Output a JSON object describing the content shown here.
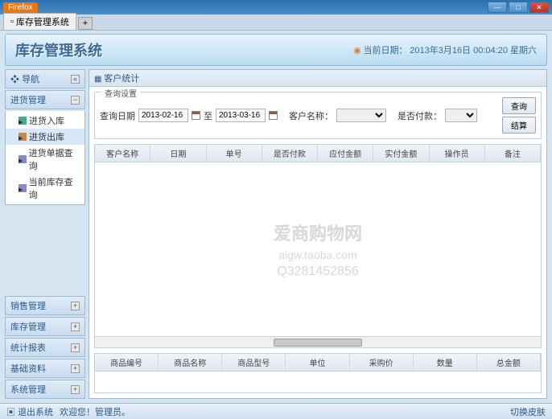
{
  "window": {
    "firefox": "Firefox",
    "tab_title": "库存管理系统"
  },
  "banner": {
    "title": "库存管理系统",
    "date_label": "当前日期：",
    "date_value": "2013年3月16日 00:04:20 星期六"
  },
  "nav": {
    "header": "导航",
    "sections": [
      {
        "title": "进货管理",
        "items": [
          "进货入库",
          "进货出库",
          "进货单据查询",
          "当前库存查询"
        ]
      },
      {
        "title": "销售管理"
      },
      {
        "title": "库存管理"
      },
      {
        "title": "统计报表"
      },
      {
        "title": "基础资料"
      },
      {
        "title": "系统管理"
      }
    ]
  },
  "content": {
    "tab": "客户统计",
    "fieldset_title": "查询设置",
    "labels": {
      "date": "查询日期",
      "to": "至",
      "cust": "客户名称：",
      "paid": "是否付款："
    },
    "values": {
      "date_from": "2013-02-16",
      "date_to": "2013-03-16",
      "cust": "",
      "paid": ""
    },
    "buttons": {
      "search": "查询",
      "settle": "结算"
    },
    "grid1_cols": [
      "客户名称",
      "日期",
      "单号",
      "是否付款",
      "应付金额",
      "实付金额",
      "操作员",
      "备注"
    ],
    "grid2_cols": [
      "商品编号",
      "商品名称",
      "商品型号",
      "单位",
      "采购价",
      "数量",
      "总金额"
    ]
  },
  "watermark": {
    "l1": "爱商购物网",
    "l2": "aigw.taoba.com",
    "l3": "Q3281452856"
  },
  "status": {
    "exit": "退出系统",
    "welcome": "欢迎您！管理员。",
    "skin": "切换皮肤"
  }
}
